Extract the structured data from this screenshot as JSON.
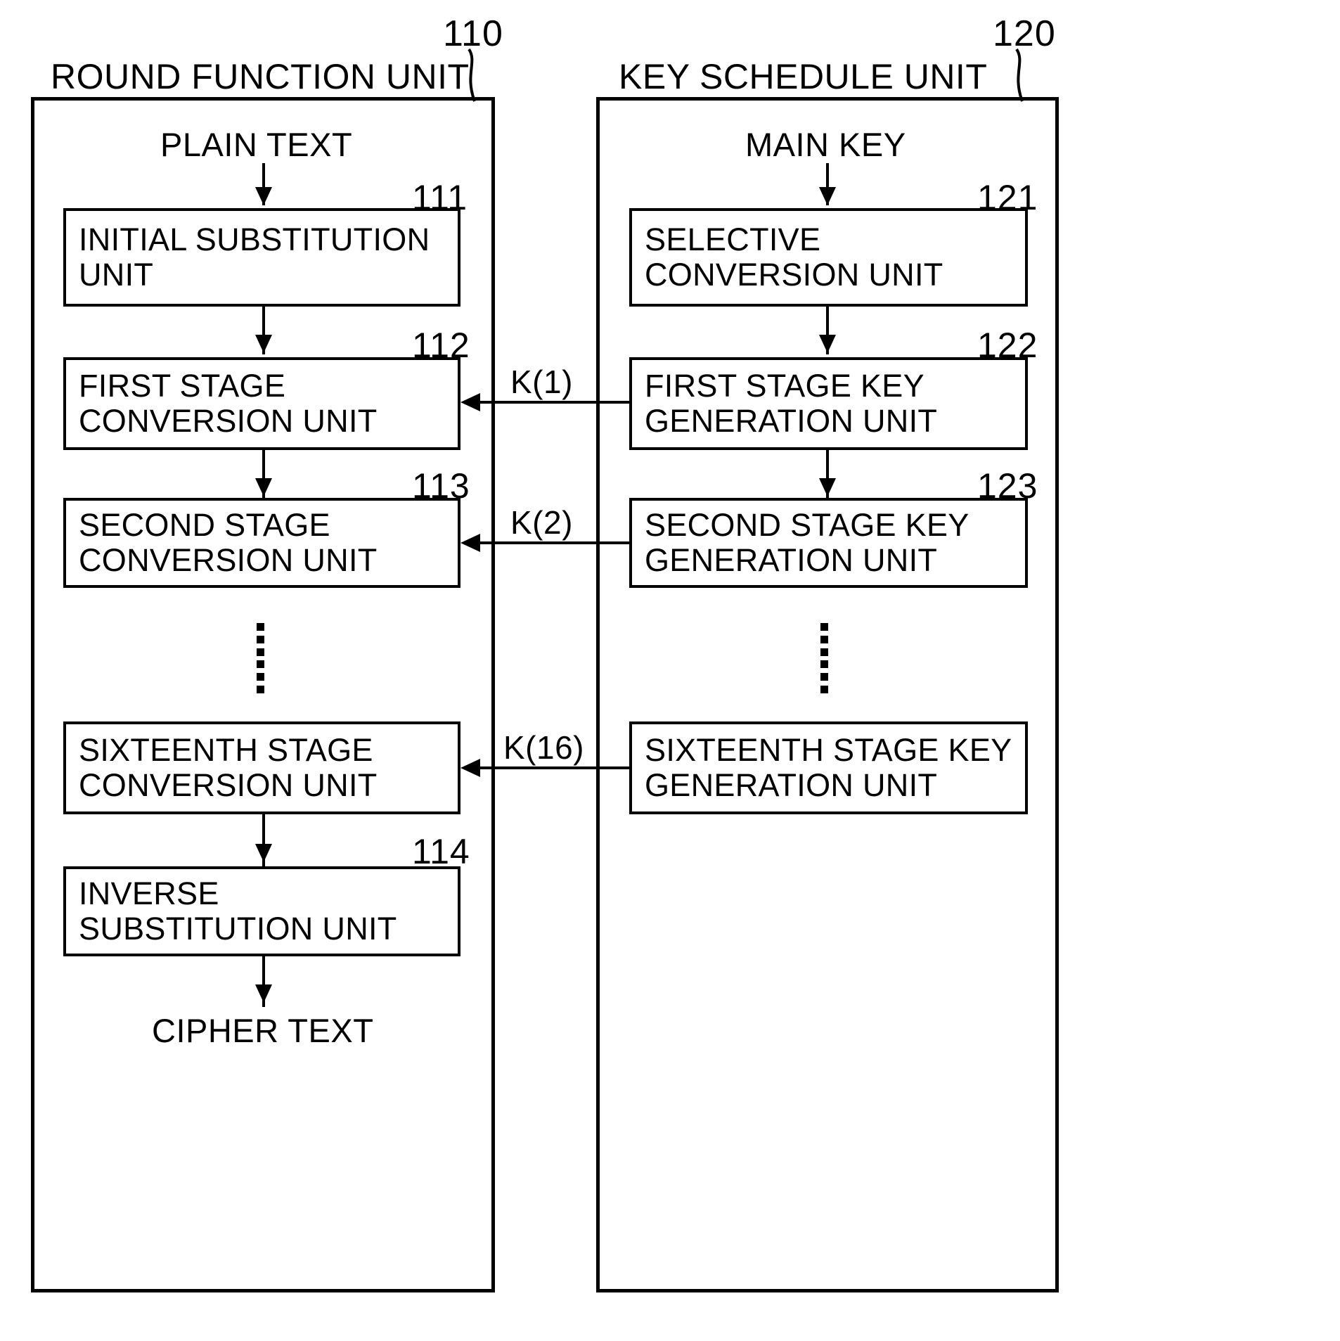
{
  "figure": {
    "title": "Block cipher round function and key schedule block diagram"
  },
  "left_panel": {
    "caption": "ROUND FUNCTION UNIT",
    "ref": "110",
    "input_label": "PLAIN TEXT",
    "output_label": "CIPHER TEXT",
    "units": [
      {
        "ref": "111",
        "label": "INITIAL SUBSTITUTION\nUNIT"
      },
      {
        "ref": "112",
        "label": "FIRST STAGE\nCONVERSION UNIT"
      },
      {
        "ref": "113",
        "label": "SECOND STAGE\nCONVERSION UNIT"
      },
      {
        "ref": "",
        "label": "SIXTEENTH STAGE\nCONVERSION UNIT"
      },
      {
        "ref": "114",
        "label": "INVERSE\nSUBSTITUTION UNIT"
      }
    ]
  },
  "right_panel": {
    "caption": "KEY SCHEDULE UNIT",
    "ref": "120",
    "input_label": "MAIN KEY",
    "units": [
      {
        "ref": "121",
        "label": "SELECTIVE\nCONVERSION UNIT"
      },
      {
        "ref": "122",
        "label": "FIRST STAGE KEY\nGENERATION UNIT"
      },
      {
        "ref": "123",
        "label": "SECOND STAGE KEY\nGENERATION UNIT"
      },
      {
        "ref": "",
        "label": "SIXTEENTH STAGE KEY\nGENERATION UNIT"
      }
    ]
  },
  "key_signals": [
    {
      "label": "K(1)"
    },
    {
      "label": "K(2)"
    },
    {
      "label": "K(16)"
    }
  ],
  "colors": {
    "line": "#000000",
    "background": "#ffffff"
  }
}
